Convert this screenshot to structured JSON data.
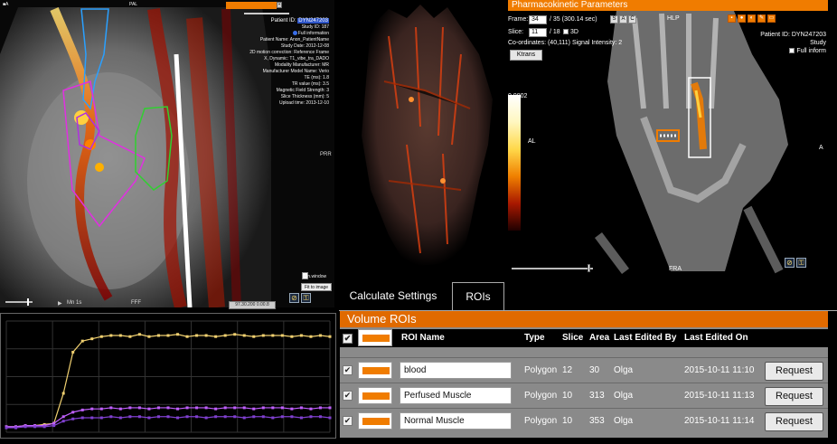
{
  "left_viewer": {
    "toolbar_left": "■A",
    "toolbar_center": "PAL",
    "colors": {
      "accent": "#f07c00",
      "roi_blue": "#2aa0ff",
      "roi_magenta": "#e030e0",
      "roi_green": "#30d030"
    },
    "info": {
      "patient_id_label": "Patient ID:",
      "patient_id_value": "DYN247203",
      "study_id": "Study ID: 187",
      "full_information": "Full information",
      "patient_name": "Patient Name: Anon_PatientName",
      "study_date": "Study Date: 2012-12-08",
      "motion_correction": "2D motion correction: Reference Frame",
      "dynamic": "X, Dynamic: T1_vibe_tra_DADO",
      "modality": "Modality Manufacturer: MR",
      "manufacturer_model": "Manufacturer Model Name: Verio",
      "te": "TE (ms): 1.8",
      "tr": "TR value (ms): 3.5",
      "magnetic_field": "Magnetic Field Strength: 3",
      "slice_thickness": "Slice Thickness (mm): 5",
      "upload_time": "Upload time: 2013-12-10"
    },
    "side_labels": {
      "right": "PRR",
      "bottom_left": "Mn 1s",
      "bottom_mid": "FFF"
    },
    "min_window_label": "Min.window",
    "fit_button": "Fit to image",
    "corner_value": "97.30.200 0.00.8"
  },
  "pk_viewer": {
    "title": "Pharmacokinetic Parameters",
    "frame_label": "Frame:",
    "frame_value": "34",
    "frame_total": "/ 35 (300.14 sec)",
    "slice_label": "Slice:",
    "slice_value": "11",
    "slice_total": "/ 18",
    "three_d_label": "3D",
    "sac_buttons": [
      "S",
      "A",
      "C"
    ],
    "coordinates": "Co-ordinates: (40,111) Signal Intensity: 2",
    "ktrans_button": "Ktrans",
    "patient_id": "Patient ID: DYN247203",
    "study": "Study",
    "full_info": "Full inform",
    "colorbar_max": "0.9802",
    "orientation": {
      "top": "HLP",
      "bottom": "FRA",
      "left_mid": "AL",
      "right_mid": "A"
    }
  },
  "tabs": [
    {
      "label": "Calculate Settings",
      "active": false
    },
    {
      "label": "ROIs",
      "active": true
    }
  ],
  "roi_table": {
    "header": "Volume ROIs",
    "columns": [
      "ROI Name",
      "Type",
      "Slice",
      "Area",
      "Last Edited By",
      "Last Edited On"
    ],
    "rows": [
      {
        "name": "blood",
        "type": "Polygon",
        "slice": "12",
        "area": "30",
        "editor": "Olga",
        "edited_on": "2015-10-11 11:10",
        "action": "Request"
      },
      {
        "name": "Perfused Muscle",
        "type": "Polygon",
        "slice": "10",
        "area": "313",
        "editor": "Olga",
        "edited_on": "2015-10-11 11:13",
        "action": "Request"
      },
      {
        "name": "Normal Muscle",
        "type": "Polygon",
        "slice": "10",
        "area": "353",
        "editor": "Olga",
        "edited_on": "2015-10-11 11:14",
        "action": "Request"
      }
    ]
  },
  "chart_data": {
    "type": "line",
    "title": "",
    "xlabel": "",
    "ylabel": "",
    "grid": true,
    "x": [
      1,
      2,
      3,
      4,
      5,
      6,
      7,
      8,
      9,
      10,
      11,
      12,
      13,
      14,
      15,
      16,
      17,
      18,
      19,
      20,
      21,
      22,
      23,
      24,
      25,
      26,
      27,
      28,
      29,
      30,
      31,
      32,
      33,
      34,
      35
    ],
    "ylim": [
      0,
      100
    ],
    "series": [
      {
        "color": "#f0d070",
        "values": [
          5,
          5,
          6,
          6,
          7,
          8,
          35,
          72,
          82,
          84,
          86,
          87,
          87,
          86,
          88,
          86,
          87,
          87,
          88,
          86,
          87,
          87,
          86,
          87,
          88,
          87,
          86,
          87,
          87,
          87,
          86,
          87,
          86,
          87,
          86
        ]
      },
      {
        "color": "#c060ff",
        "values": [
          5,
          5,
          6,
          6,
          6,
          8,
          14,
          18,
          20,
          21,
          21,
          22,
          21,
          22,
          22,
          21,
          22,
          22,
          21,
          22,
          22,
          22,
          21,
          22,
          22,
          22,
          21,
          22,
          22,
          22,
          21,
          22,
          21,
          22,
          22
        ]
      },
      {
        "color": "#8040d0",
        "values": [
          4,
          4,
          5,
          5,
          5,
          6,
          10,
          12,
          13,
          13,
          13,
          14,
          13,
          14,
          14,
          13,
          14,
          14,
          13,
          14,
          14,
          13,
          14,
          14,
          14,
          13,
          14,
          14,
          13,
          14,
          14,
          13,
          14,
          14,
          13
        ]
      }
    ]
  }
}
